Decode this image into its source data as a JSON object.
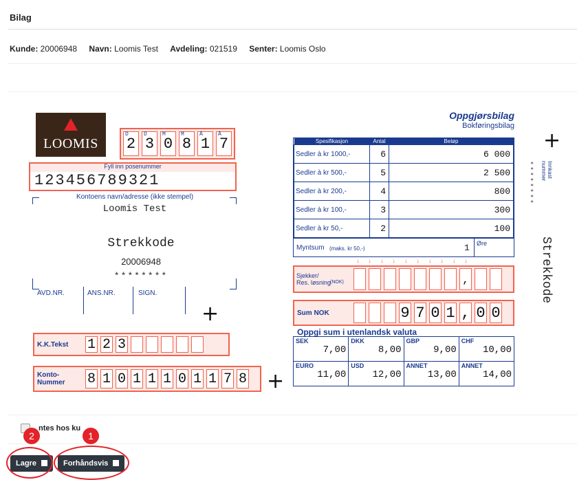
{
  "header": {
    "title": "Bilag"
  },
  "info": {
    "kunde_label": "Kunde:",
    "kunde": "20006948",
    "navn_label": "Navn:",
    "navn": "Loomis Test",
    "avdeling_label": "Avdeling:",
    "avdeling": "021519",
    "senter_label": "Senter:",
    "senter": "Loomis Oslo"
  },
  "voucher": {
    "logo": "LOOMIS",
    "date_letters": [
      "D",
      "D",
      "M",
      "M",
      "Å",
      "Å"
    ],
    "date_digits": [
      "2",
      "3",
      "0",
      "8",
      "1",
      "7"
    ],
    "pose_label": "Fyll inn posenummer",
    "pose_number": "123456789321",
    "konto_label": "Kontoens navn/adresse (ikke stempel)",
    "konto_name": "Loomis Test",
    "strekkode": "Strekkode",
    "barcode_number": "20006948",
    "stars": "********",
    "avd_label": "AVD.NR.",
    "ans_label": "ANS.NR.",
    "sign_label": "SIGN.",
    "kk_label": "K.K.Tekst",
    "kk_digits": [
      "1",
      "2",
      "3",
      "",
      "",
      "",
      "",
      ""
    ],
    "kontonr_label": "Konto-\nNummer",
    "kontonr_digits": [
      "8",
      "1",
      "0",
      "1",
      "1",
      "1",
      "0",
      "1",
      "1",
      "7",
      "8"
    ],
    "oppgjor_title": "Oppgjørsbilag",
    "oppgjor_sub": "Bokføringsbilag",
    "spec_headers": [
      "Spesifikasjon",
      "Antal",
      "Beløp"
    ],
    "spec_rows": [
      {
        "label": "Sedler à kr 1000,-",
        "antal": "6",
        "belop": "6 000"
      },
      {
        "label": "Sedler à kr 500,-",
        "antal": "5",
        "belop": "2 500"
      },
      {
        "label": "Sedler à kr 200,-",
        "antal": "4",
        "belop": "800"
      },
      {
        "label": "Sedler à kr 100,-",
        "antal": "3",
        "belop": "300"
      },
      {
        "label": "Sedler à kr 50,-",
        "antal": "2",
        "belop": "100"
      }
    ],
    "mynt_label": "Myntsum",
    "mynt_note": "(maks. kr 50,-)",
    "mynt_value": "1",
    "ore_label": "Øre",
    "sjekker_label": "Sjekker/\nRes. løsning",
    "sjekker_note": "(NOK)",
    "sum_label": "Sum NOK",
    "sum_digits": [
      "",
      "",
      "",
      "9",
      "7",
      "0",
      "1",
      ",",
      "0",
      "0"
    ],
    "sjekker_comma": ",",
    "valuta_title": "Oppgi sum i utenlandsk valuta",
    "valuta": [
      {
        "cur": "SEK",
        "amt": "7,00"
      },
      {
        "cur": "DKK",
        "amt": "8,00"
      },
      {
        "cur": "GBP",
        "amt": "9,00"
      },
      {
        "cur": "CHF",
        "amt": "10,00"
      },
      {
        "cur": "EURO",
        "amt": "11,00"
      },
      {
        "cur": "USD",
        "amt": "12,00"
      },
      {
        "cur": "ANNET",
        "amt": "13,00"
      },
      {
        "cur": "ANNET",
        "amt": "14,00"
      }
    ],
    "innkast_label": "Innkast\nnummer",
    "innkast_stars": "********",
    "side_strekkode": "Strekkode"
  },
  "checkbox_label": "ntes hos ku",
  "buttons": {
    "lagre": "Lagre",
    "forhandsvis": "Forhåndsvis"
  },
  "badges": [
    "2",
    "1"
  ],
  "colors": {
    "accent_red": "#f0634f",
    "navy": "#1a3a8f",
    "button": "#2e3640",
    "annotation": "#e2232a"
  }
}
